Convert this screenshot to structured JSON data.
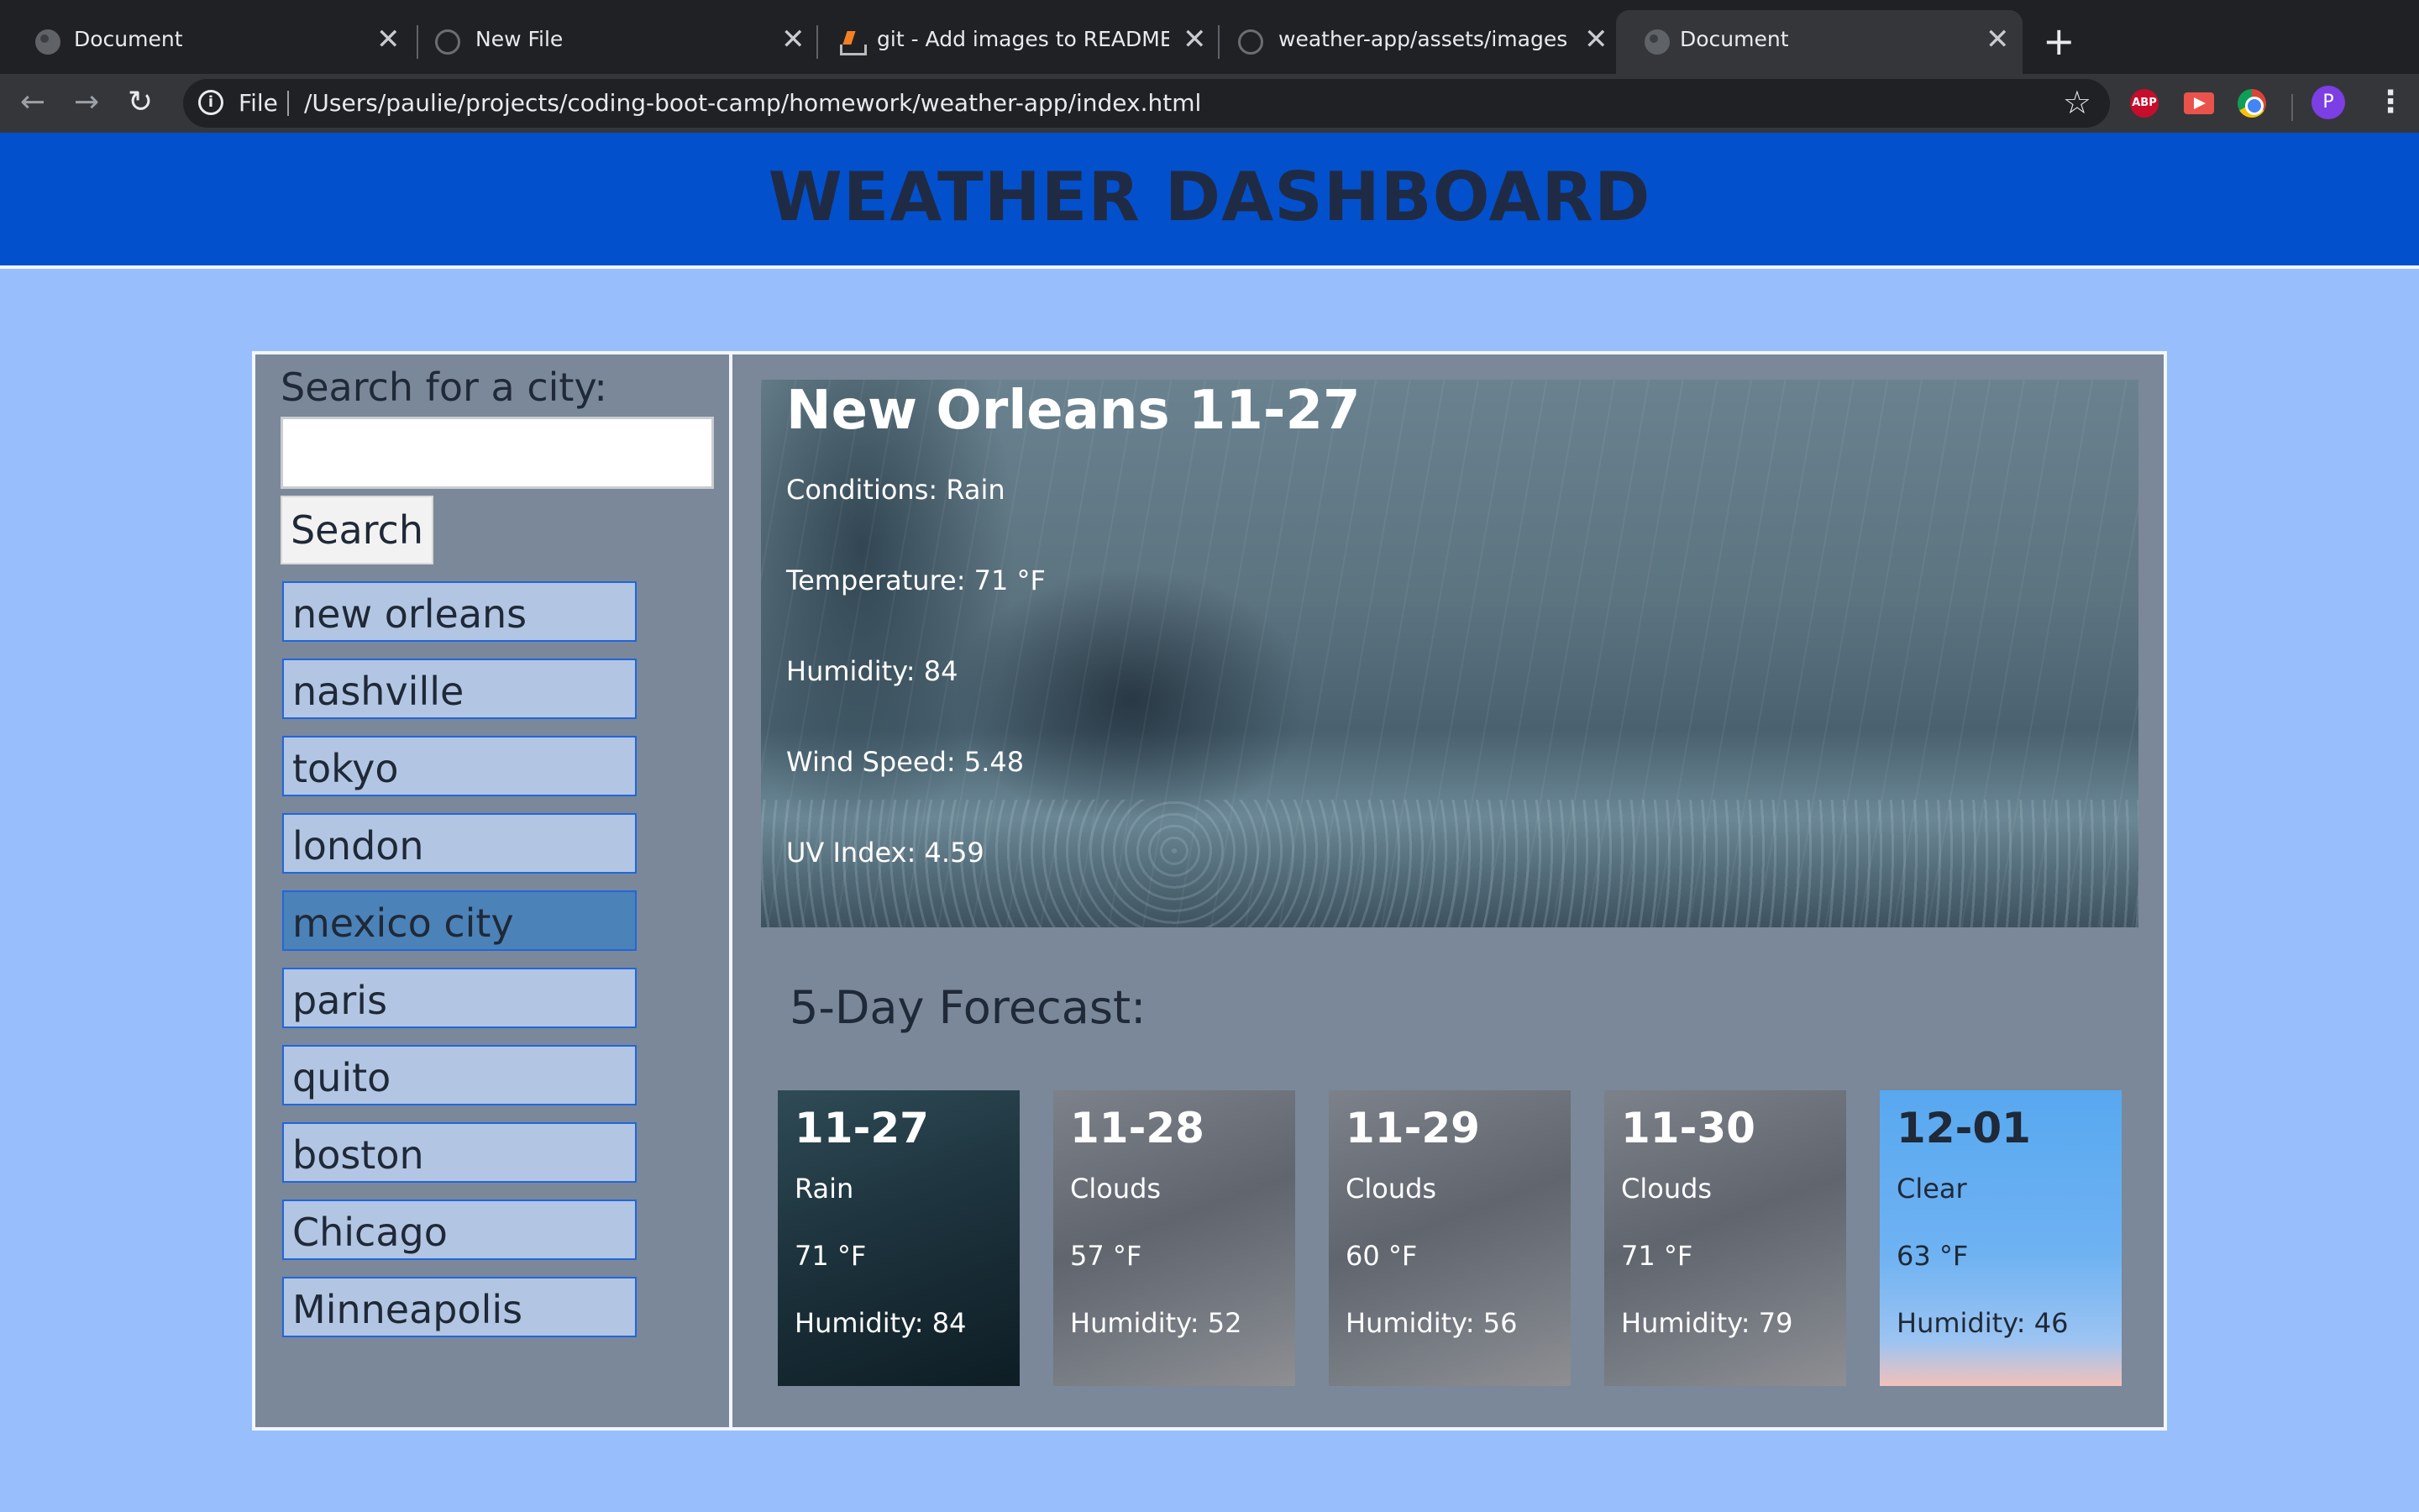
{
  "browser": {
    "tabs": [
      {
        "title": "Document",
        "icon": "globe-icon"
      },
      {
        "title": "New File",
        "icon": "github-icon"
      },
      {
        "title": "git - Add images to README.md",
        "icon": "stackoverflow-icon"
      },
      {
        "title": "weather-app/assets/images at m",
        "icon": "github-icon"
      },
      {
        "title": "Document",
        "icon": "globe-icon"
      }
    ],
    "active_tab_index": 4,
    "close_glyph": "✕",
    "new_tab_glyph": "+",
    "address": {
      "scheme": "File",
      "url": "/Users/paulie/projects/coding-boot-camp/homework/weather-app/index.html"
    },
    "extensions": {
      "abp": "ABP"
    },
    "profile_initial": "P"
  },
  "page": {
    "title": "WEATHER DASHBOARD",
    "colors": {
      "header": "#0350cc",
      "background": "#98bffc",
      "panel": "#7a8899"
    },
    "search": {
      "label": "Search for a city:",
      "input_value": "",
      "button_label": "Search"
    },
    "history": [
      "new orleans",
      "nashville",
      "tokyo",
      "london",
      "mexico city",
      "paris",
      "quito",
      "boston",
      "Chicago",
      "Minneapolis"
    ],
    "history_active": "mexico city",
    "current": {
      "heading": "New Orleans 11-27",
      "conditions": "Conditions: Rain",
      "temperature": "Temperature: 71 °F",
      "humidity": "Humidity: 84",
      "wind_speed": "Wind Speed: 5.48",
      "uv_index": "UV Index: 4.59"
    },
    "forecast_title": "5-Day Forecast:",
    "forecast": [
      {
        "date": "11-27",
        "condition": "Rain",
        "temp": "71 °F",
        "humidity": "Humidity: 84"
      },
      {
        "date": "11-28",
        "condition": "Clouds",
        "temp": "57 °F",
        "humidity": "Humidity: 52"
      },
      {
        "date": "11-29",
        "condition": "Clouds",
        "temp": "60 °F",
        "humidity": "Humidity: 56"
      },
      {
        "date": "11-30",
        "condition": "Clouds",
        "temp": "71 °F",
        "humidity": "Humidity: 79"
      },
      {
        "date": "12-01",
        "condition": "Clear",
        "temp": "63 °F",
        "humidity": "Humidity: 46"
      }
    ]
  }
}
